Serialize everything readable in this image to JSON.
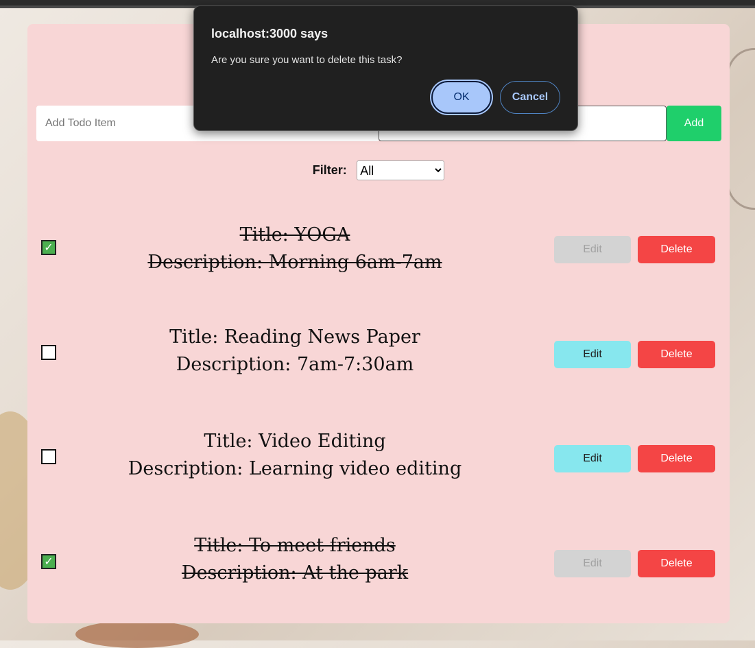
{
  "app": {
    "add_form": {
      "title_placeholder": "Add Todo Item",
      "description_value": "",
      "add_label": "Add"
    },
    "filter": {
      "label": "Filter:",
      "selected": "All"
    },
    "todos": [
      {
        "title": "Title: YOGA",
        "description": "Description: Morning 6am-7am",
        "completed": true
      },
      {
        "title": "Title: Reading News Paper",
        "description": "Description: 7am-7:30am",
        "completed": false
      },
      {
        "title": "Title: Video Editing",
        "description": "Description: Learning video editing",
        "completed": false
      },
      {
        "title": "Title: To meet friends",
        "description": "Description: At the park",
        "completed": true
      }
    ],
    "actions": {
      "edit_label": "Edit",
      "delete_label": "Delete"
    }
  },
  "dialog": {
    "title": "localhost:3000 says",
    "message": "Are you sure you want to delete this task?",
    "ok_label": "OK",
    "cancel_label": "Cancel"
  },
  "icons": {
    "checkmark": "check-icon",
    "dropdown": "chevron-down-icon"
  },
  "colors": {
    "card_background": "#f8d6d6",
    "add_button": "#1fcf6b",
    "edit_button": "#87e7ee",
    "edit_button_disabled": "#d3d3d3",
    "delete_button": "#f44545",
    "checkbox_checked": "#4caf50",
    "dialog_background": "#202020",
    "dialog_ok": "#a8c7fa"
  }
}
